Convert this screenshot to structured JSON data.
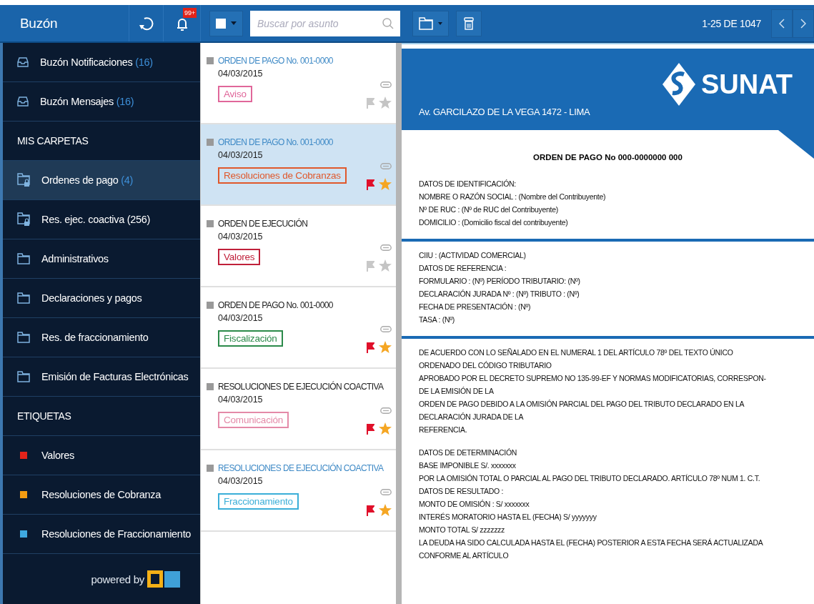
{
  "header": {
    "title": "Buzón",
    "notification_badge": "99+",
    "search": {
      "placeholder": "Buscar por asunto"
    },
    "pagination": "1-25 DE 1047"
  },
  "sidebar": {
    "mailboxes": [
      {
        "label": "Buzón Notificaciones",
        "count": "(16)",
        "selected": false
      },
      {
        "label": "Buzón Mensajes",
        "count": "(16)",
        "selected": false
      }
    ],
    "folders_heading": "MIS CARPETAS",
    "folders": [
      {
        "kind": "locked",
        "label": "Ordenes de pago",
        "count": "(4)",
        "selected": true
      },
      {
        "kind": "locked",
        "label": "Res. ejec. coactiva (256)",
        "selected": false
      },
      {
        "kind": "folder",
        "label": "Administrativos",
        "selected": false
      },
      {
        "kind": "folder",
        "label": "Declaraciones y pagos",
        "selected": false
      },
      {
        "kind": "folder",
        "label": "Res. de fraccionamiento",
        "selected": false
      },
      {
        "kind": "folder",
        "label": "Emisión de Facturas Electrónicas",
        "selected": false
      }
    ],
    "tags_heading": "ETIQUETAS",
    "tags": [
      {
        "label": "Valores",
        "color": "#e2231a"
      },
      {
        "label": "Resoluciones de Cobranza",
        "color": "#f39c12"
      },
      {
        "label": "Resoluciones de Fraccionamiento",
        "color": "#3fa9e0"
      }
    ],
    "footer": "powered by"
  },
  "messages": [
    {
      "title": "ORDEN DE PAGO No. 001-0000",
      "date": "04/03/2015",
      "tag": "Aviso",
      "color": "#e0679a",
      "unread": true,
      "flagged": false,
      "starred": false,
      "selected": false
    },
    {
      "title": "ORDEN DE PAGO No. 001-0000",
      "date": "04/03/2015",
      "tag": "Resoluciones de Cobranzas",
      "color": "#e0582b",
      "unread": true,
      "flagged": true,
      "starred": true,
      "selected": true
    },
    {
      "title": "ORDEN DE EJECUCIÓN",
      "date": "04/03/2015",
      "tag": "Valores",
      "color": "#c0203a",
      "unread": false,
      "flagged": false,
      "starred": false,
      "selected": false
    },
    {
      "title": "ORDEN DE PAGO No. 001-0000",
      "date": "04/03/2015",
      "tag": "Fiscalización",
      "color": "#2b8a4a",
      "unread": false,
      "flagged": true,
      "starred": true,
      "selected": false
    },
    {
      "title": "RESOLUCIONES DE EJECUCIÓN COACTIVA",
      "date": "04/03/2015",
      "tag": "Comunicación",
      "color": "#e48aa8",
      "unread": false,
      "flagged": true,
      "starred": true,
      "selected": false
    },
    {
      "title": "RESOLUCIONES DE EJECUCIÓN COACTIVA",
      "date": "04/03/2015",
      "tag": "Fraccionamiento",
      "color": "#3aaed8",
      "unread": true,
      "flagged": true,
      "starred": true,
      "selected": false
    }
  ],
  "document": {
    "address": "Av. GARCILAZO DE LA VEGA 1472 - LIMA",
    "logo_text": "SUNAT",
    "title": "ORDEN DE PAGO No 000-0000000 000",
    "sections": [
      {
        "divider": false,
        "lines": [
          "DATOS DE IDENTIFICACIÓN:",
          "NOMBRE O RAZÓN SOCIAL : (Nombre del Contribuyente)",
          "Nº DE RUC : (Nº de RUC del Contribuyente)",
          "DOMICILIO : (Domicilio fiscal del contribuyente)"
        ]
      },
      {
        "divider": true,
        "lines": [
          "CIIU : (ACTIVIDAD COMERCIAL)",
          "DATOS DE REFERENCIA :",
          "FORMULARIO : (Nº) PERÍODO TRIBUTARIO: (Nº)",
          "DECLARACIÓN JURADA Nº : (Nº) TRIBUTO : (Nº)",
          "FECHA DE PRESENTACIÓN : (Nº)",
          "TASA : (Nº)"
        ]
      },
      {
        "divider": true,
        "lines": [
          "DE ACUERDO CON LO SEÑALADO EN EL NUMERAL 1 DEL ARTÍCULO 78º DEL TEXTO ÚNICO",
          "ORDENADO DEL CÓDIGO TRIBUTARIO",
          "APROBADO POR EL DECRETO SUPREMO NO 135-99-EF Y NORMAS MODIFICATORIAS, CORRESPON-",
          "DE LA EMISIÓN DE LA",
          "ORDEN DE PAGO DEBIDO A LA OMISIÓN PARCIAL DEL PAGO DEL TRIBUTO DECLARADO EN LA",
          "DECLARACIÓN JURADA DE LA",
          "REFERENCIA."
        ]
      },
      {
        "divider": false,
        "lines": [
          "DATOS DE DETERMINACIÓN",
          "BASE IMPONIBLE S/. xxxxxxx",
          "POR LA OMISIÓN TOTAL O PARCIAL AL PAGO DEL TRIBUTO DECLARADO. ARTÍCULO 78º NUM 1. C.T.",
          "DATOS DE RESULTADO :",
          "MONTO DE OMISIÓN : S/ xxxxxxx",
          "INTERÉS MORATORIO HASTA EL (FECHA) S/ yyyyyyy",
          "MONTO TOTAL S/ zzzzzzz",
          "LA DEUDA HA SIDO CALCULADA HASTA EL (FECHA) POSTERIOR A ESTA FECHA SERÁ ACTUALIZADA",
          "CONFORME AL ARTÍCULO"
        ]
      }
    ]
  }
}
